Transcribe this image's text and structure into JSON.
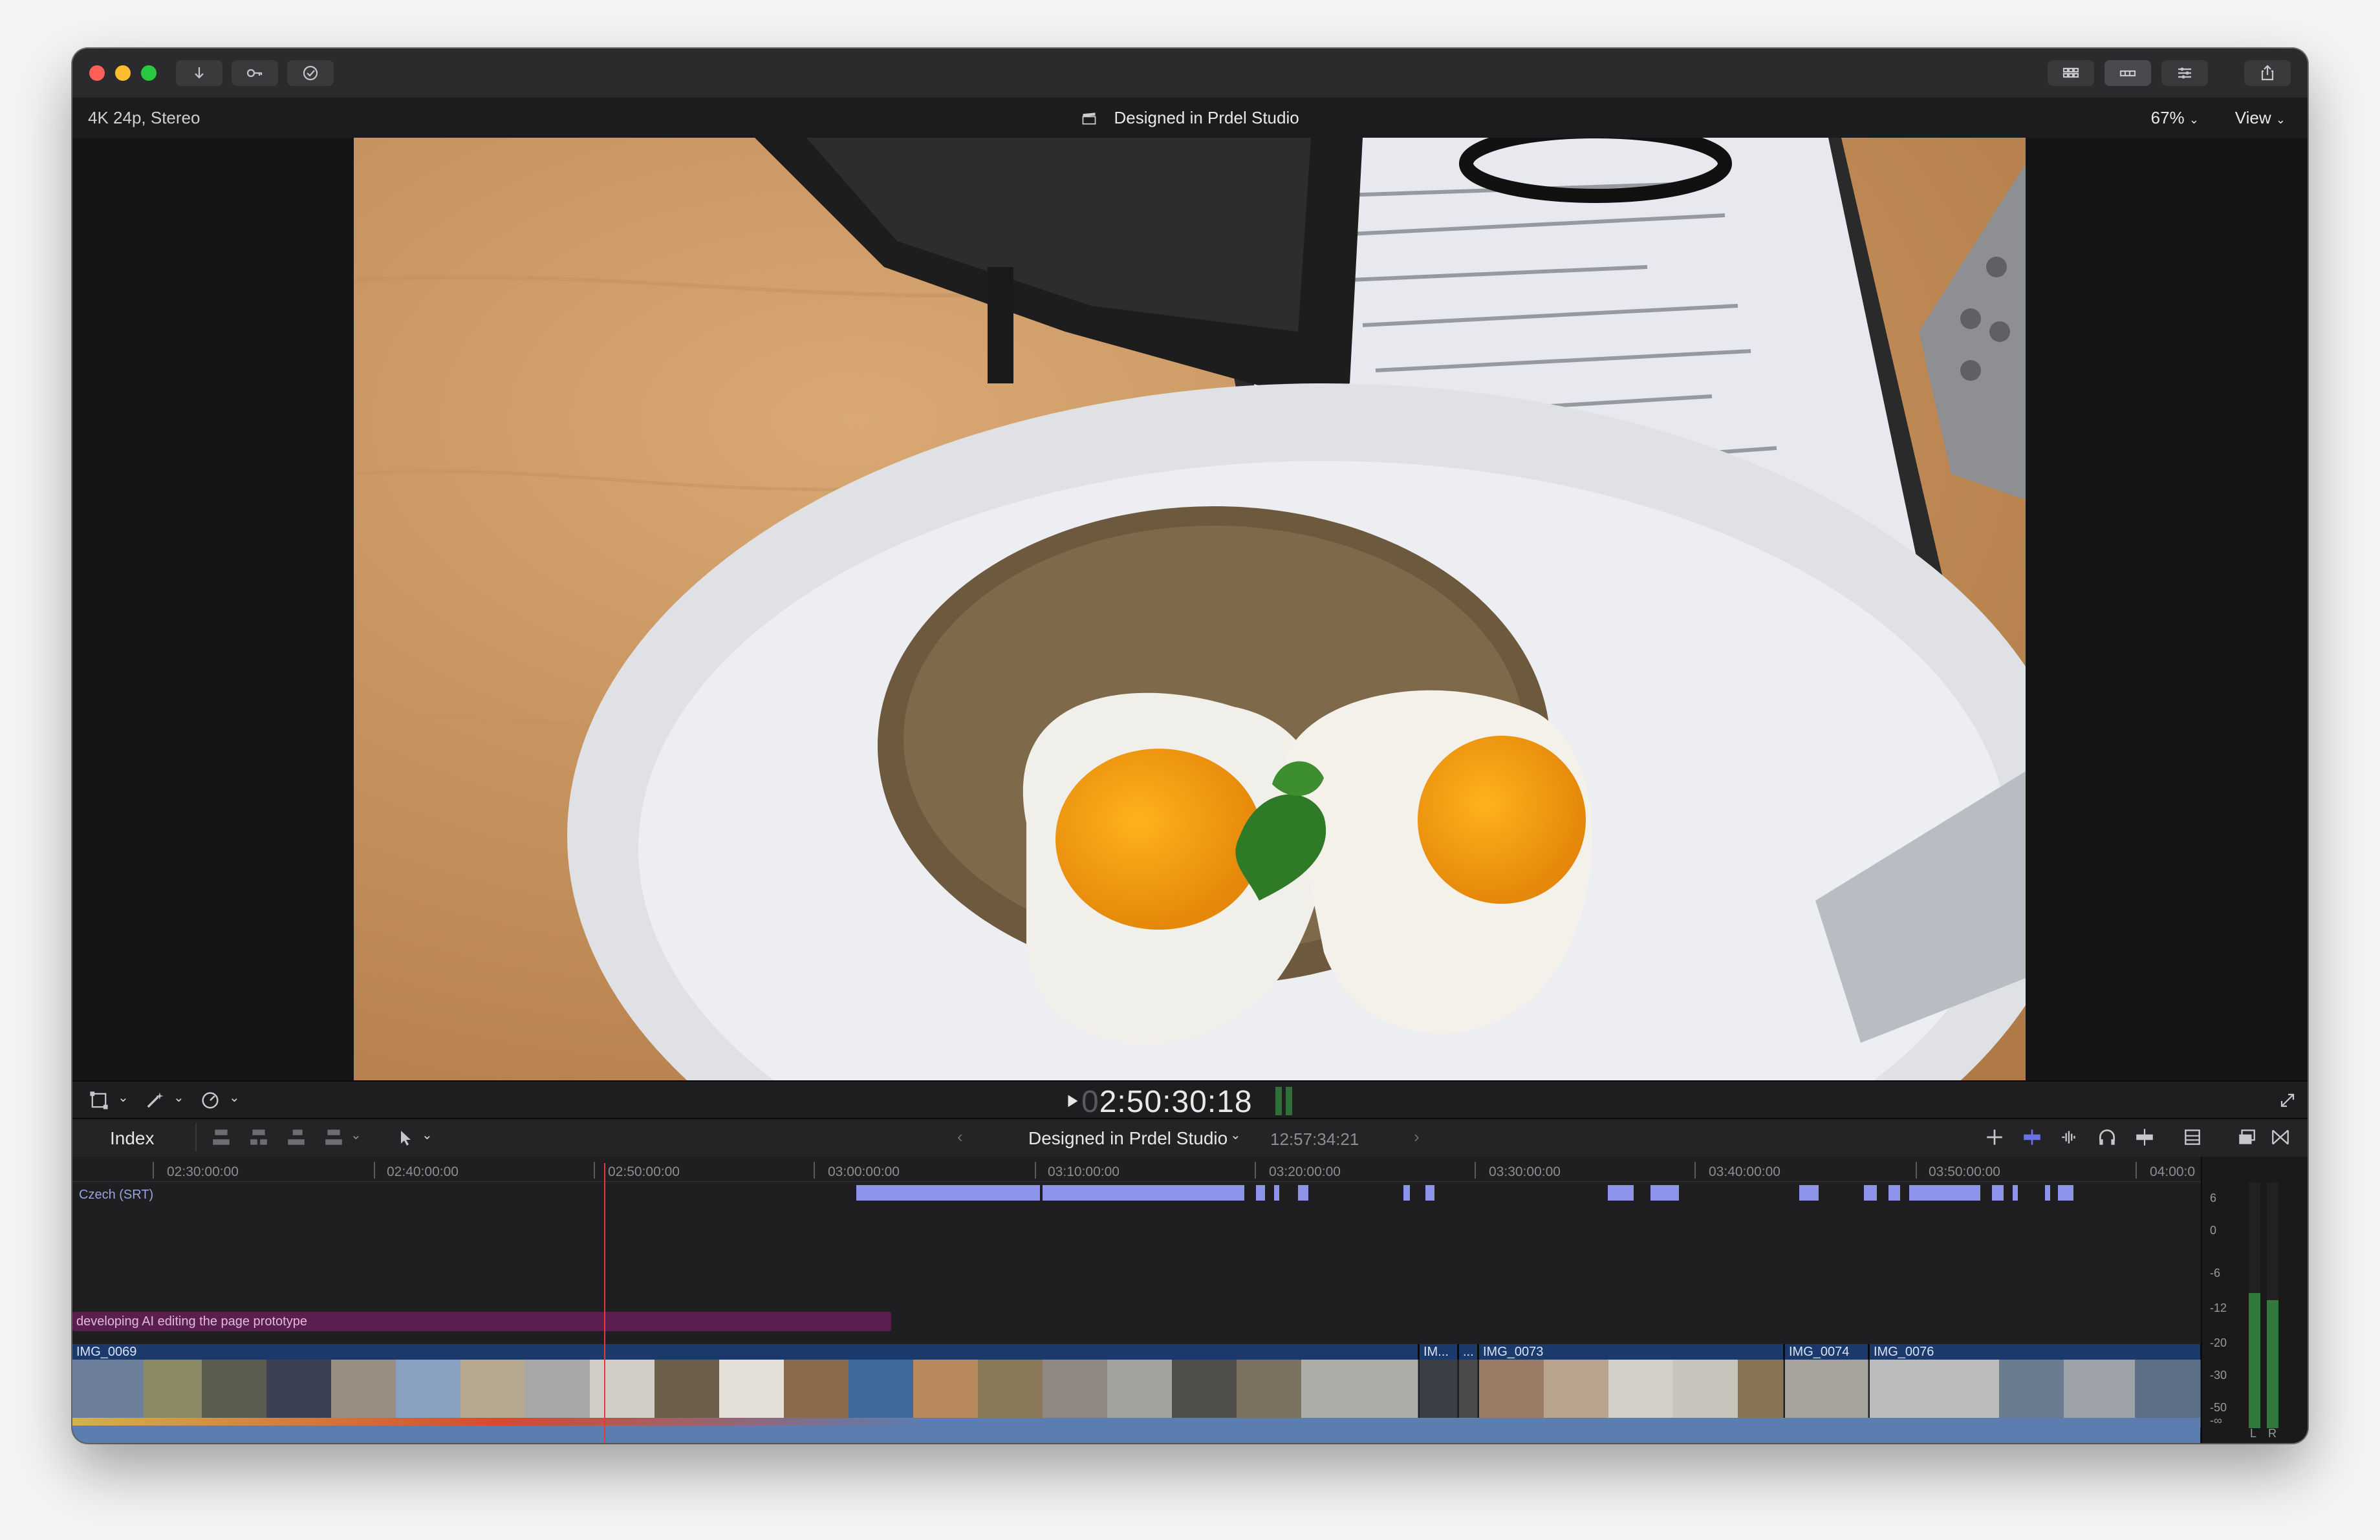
{
  "window": {
    "format_label": "4K 24p, Stereo",
    "viewer_title": "Designed in Prdel Studio",
    "zoom": "67%",
    "view_menu": "View"
  },
  "colors": {
    "accent": "#6b72e6",
    "caption": "#8d93e8",
    "title_clip": "#5a1f4f",
    "clip_header": "#1b3a6b",
    "audio": "#5c7db0",
    "playhead": "#e23b3b"
  },
  "toolbar": {
    "left_buttons": [
      "download-icon",
      "key-icon",
      "checkmark-icon"
    ],
    "right_buttons": [
      "browser-icon",
      "timeline-icon",
      "inspector-icon",
      "share-icon"
    ]
  },
  "viewer_controls": {
    "timecode_dim": "0",
    "timecode": "2:50:30:18"
  },
  "timeline_header": {
    "index_label": "Index",
    "project_name": "Designed in Prdel Studio",
    "project_duration": "12:57:34:21"
  },
  "timeline": {
    "ruler": [
      "02:30:00:00",
      "02:40:00:00",
      "02:50:00:00",
      "03:00:00:00",
      "03:10:00:00",
      "03:20:00:00",
      "03:30:00:00",
      "03:40:00:00",
      "03:50:00:00",
      "04:00:0"
    ],
    "caption_lane": "Czech (SRT)",
    "title_clip": "developing AI editing the page prototype",
    "clips": [
      "IMG_0069",
      "IM...",
      "...",
      "IMG_0073",
      "IMG_0074",
      "IMG_0076"
    ]
  },
  "meter": {
    "scale": [
      "6",
      "0",
      "-6",
      "-12",
      "-20",
      "-30",
      "-50",
      "-∞"
    ],
    "channels": [
      "L",
      "R"
    ],
    "levels": [
      0.55,
      0.52
    ]
  }
}
